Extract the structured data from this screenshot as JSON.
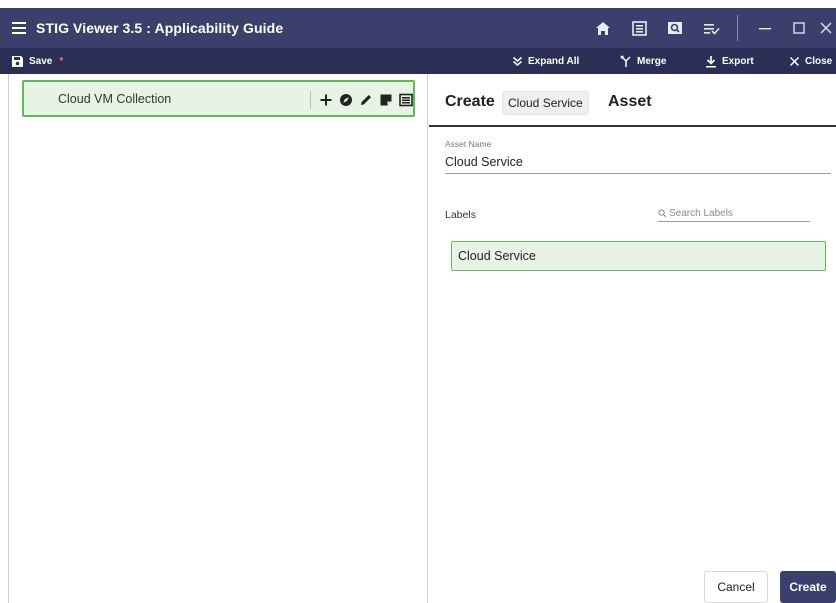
{
  "window": {
    "title": "STIG Viewer 3.5 : Applicability Guide"
  },
  "toolbar": {
    "save_label": "Save",
    "save_modified_marker": "*",
    "expand_all_label": "Expand All",
    "merge_label": "Merge",
    "export_label": "Export",
    "close_label": "Close"
  },
  "tree": {
    "items": [
      {
        "label": "Cloud VM Collection",
        "actions": [
          "add-icon",
          "compass-icon",
          "pencil-icon",
          "note-icon",
          "list-icon"
        ]
      }
    ]
  },
  "form": {
    "header_prefix": "Create",
    "header_chip": "Cloud Service",
    "header_suffix": "Asset",
    "asset_name_label": "Asset Name",
    "asset_name_value": "Cloud Service",
    "labels_title": "Labels",
    "search_placeholder": "Search Labels",
    "label_items": [
      "Cloud Service"
    ],
    "cancel_label": "Cancel",
    "create_label": "Create"
  },
  "colors": {
    "titlebar": "#3b3f6b",
    "toolbar": "#2c2f55",
    "selection_fill": "#e7f4e5",
    "selection_border": "#5bbd55",
    "modified_star": "#ff6b81"
  }
}
